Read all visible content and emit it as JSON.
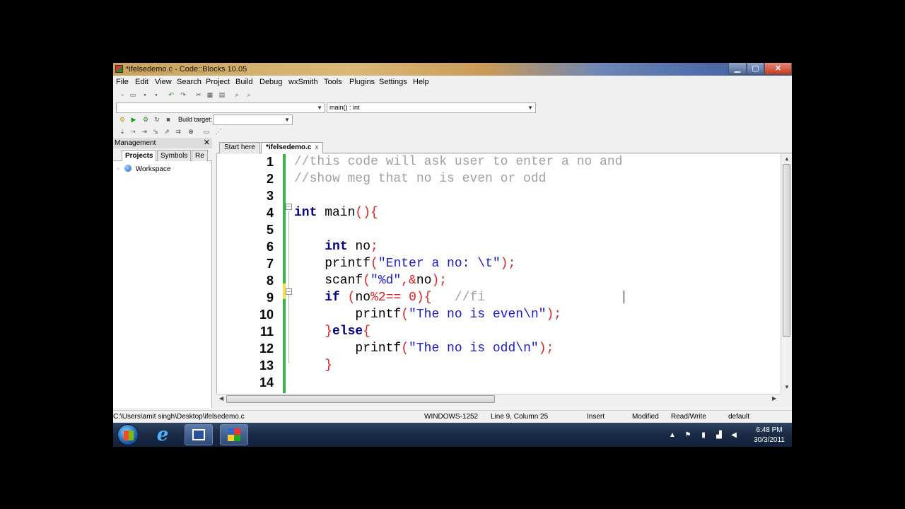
{
  "window": {
    "title": "*ifelsedemo.c - Code::Blocks 10.05",
    "min": "▁",
    "max": "▢",
    "close": "✕"
  },
  "menu": [
    "File",
    "Edit",
    "View",
    "Search",
    "Project",
    "Build",
    "Debug",
    "wxSmith",
    "Tools",
    "Plugins",
    "Settings",
    "Help"
  ],
  "toolbar": {
    "scope_combo": "",
    "function_combo": "main() : int",
    "build_target_label": "Build target:",
    "build_target_value": ""
  },
  "management": {
    "title": "Management",
    "tabs": [
      "Projects",
      "Symbols",
      "Re"
    ],
    "active_tab": "Projects",
    "tree": [
      {
        "label": "Workspace"
      }
    ]
  },
  "editor": {
    "tabs": [
      {
        "label": "Start here",
        "active": false
      },
      {
        "label": "*ifelsedemo.c",
        "active": true,
        "close": "x"
      }
    ],
    "lines": [
      [
        {
          "t": "//this code will ask user to enter a no and",
          "c": "c-cm"
        }
      ],
      [
        {
          "t": "//show meg that no is even or odd",
          "c": "c-cm"
        }
      ],
      [],
      [
        {
          "t": "int",
          "c": "c-kw"
        },
        {
          "t": " main",
          "c": ""
        },
        {
          "t": "(){",
          "c": "c-op"
        }
      ],
      [],
      [
        {
          "t": "    ",
          "c": ""
        },
        {
          "t": "int",
          "c": "c-kw"
        },
        {
          "t": " no",
          "c": ""
        },
        {
          "t": ";",
          "c": "c-op"
        }
      ],
      [
        {
          "t": "    printf",
          "c": ""
        },
        {
          "t": "(",
          "c": "c-op"
        },
        {
          "t": "\"Enter a no: \\t\"",
          "c": "c-str"
        },
        {
          "t": ");",
          "c": "c-op"
        }
      ],
      [
        {
          "t": "    scanf",
          "c": ""
        },
        {
          "t": "(",
          "c": "c-op"
        },
        {
          "t": "\"%d\"",
          "c": "c-str"
        },
        {
          "t": ",&",
          "c": "c-op"
        },
        {
          "t": "no",
          "c": ""
        },
        {
          "t": ");",
          "c": "c-op"
        }
      ],
      [
        {
          "t": "    ",
          "c": ""
        },
        {
          "t": "if",
          "c": "c-kw"
        },
        {
          "t": " ",
          "c": ""
        },
        {
          "t": "(",
          "c": "c-op"
        },
        {
          "t": "no",
          "c": ""
        },
        {
          "t": "%",
          "c": "c-op"
        },
        {
          "t": "2",
          "c": "c-num"
        },
        {
          "t": "==",
          "c": "c-op"
        },
        {
          "t": " ",
          "c": ""
        },
        {
          "t": "0",
          "c": "c-num"
        },
        {
          "t": "){",
          "c": "c-op"
        },
        {
          "t": "   //fi",
          "c": "c-cm"
        }
      ],
      [
        {
          "t": "        printf",
          "c": ""
        },
        {
          "t": "(",
          "c": "c-op"
        },
        {
          "t": "\"The no is even\\n\"",
          "c": "c-str"
        },
        {
          "t": ");",
          "c": "c-op"
        }
      ],
      [
        {
          "t": "    ",
          "c": ""
        },
        {
          "t": "}",
          "c": "c-op"
        },
        {
          "t": "else",
          "c": "c-kw"
        },
        {
          "t": "{",
          "c": "c-op"
        }
      ],
      [
        {
          "t": "        printf",
          "c": ""
        },
        {
          "t": "(",
          "c": "c-op"
        },
        {
          "t": "\"The no is odd\\n\"",
          "c": "c-str"
        },
        {
          "t": ");",
          "c": "c-op"
        }
      ],
      [
        {
          "t": "    ",
          "c": ""
        },
        {
          "t": "}",
          "c": "c-op"
        }
      ],
      []
    ],
    "line_numbers": [
      "1",
      "2",
      "3",
      "4",
      "5",
      "6",
      "7",
      "8",
      "9",
      "10",
      "11",
      "12",
      "13",
      "14"
    ]
  },
  "status": {
    "path": "C:\\Users\\amit singh\\Desktop\\ifelsedemo.c",
    "encoding": "WINDOWS-1252",
    "position": "Line 9, Column 25",
    "mode": "Insert",
    "modified": "Modified",
    "access": "Read/Write",
    "lang": "default"
  },
  "taskbar": {
    "time": "6:48 PM",
    "date": "30/3/2011",
    "ie_glyph": "e"
  },
  "colors": {
    "changebar": "#37b44a",
    "modified_line": "#f2e14c",
    "keyword": "#00008b",
    "string": "#1a1acd",
    "operator": "#e02020",
    "comment": "#a0a0a0"
  }
}
